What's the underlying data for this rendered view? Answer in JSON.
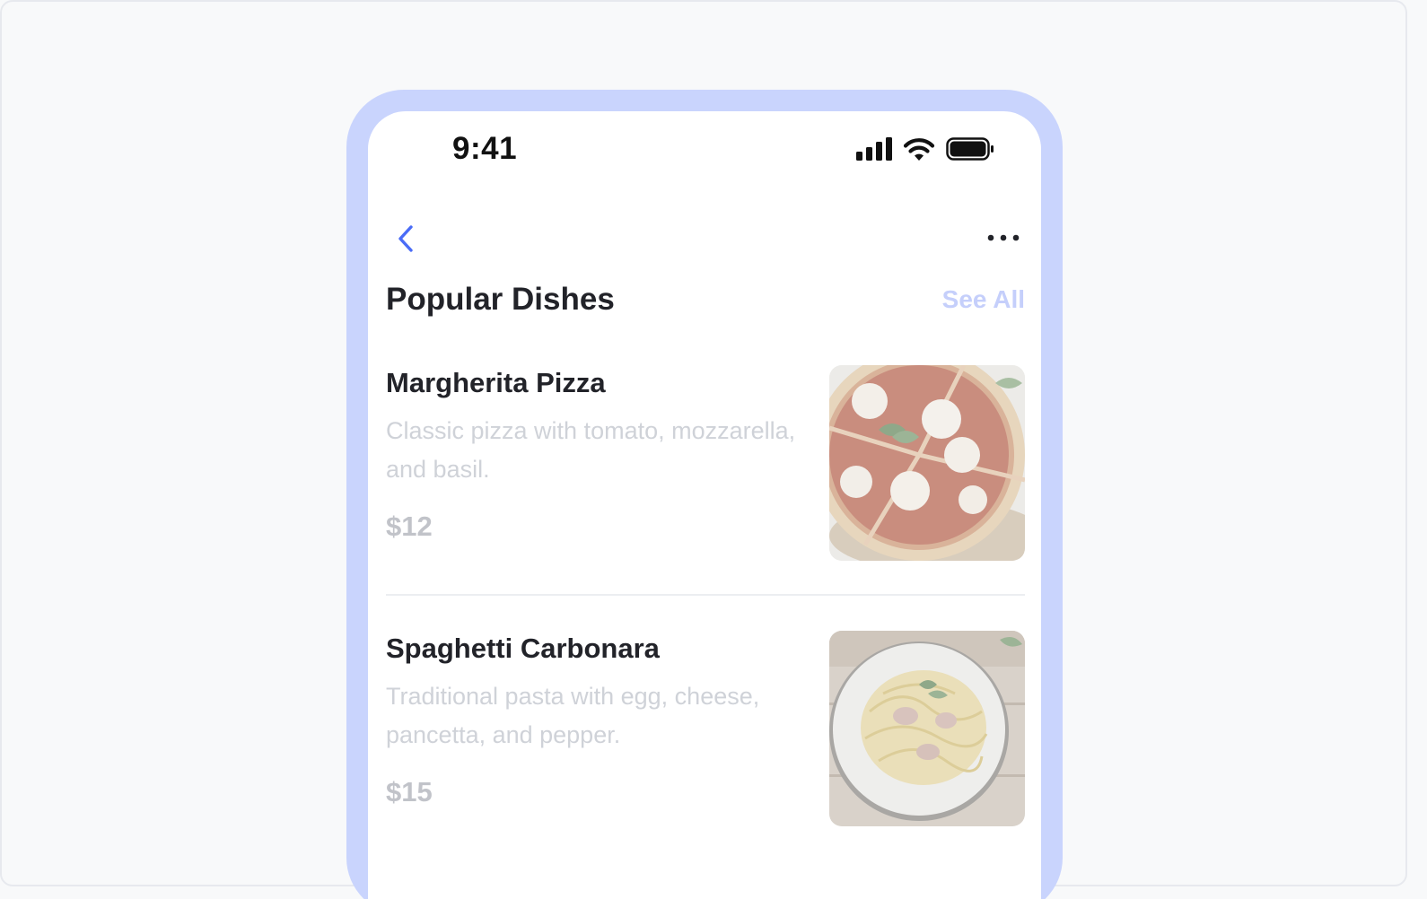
{
  "status_bar": {
    "time": "9:41",
    "icons": [
      "signal-icon",
      "wifi-icon",
      "battery-icon"
    ]
  },
  "nav": {
    "back_icon": "chevron-left-icon",
    "more_icon": "more-horizontal-icon"
  },
  "section": {
    "title": "Popular Dishes",
    "see_all": "See All"
  },
  "dishes": [
    {
      "name": "Margherita Pizza",
      "description": "Classic pizza with tomato, mozzarella, and basil.",
      "price": "$12",
      "image_icon": "pizza-image"
    },
    {
      "name": "Spaghetti Carbonara",
      "description": "Traditional pasta with egg, cheese, pancetta, and pepper.",
      "price": "$15",
      "image_icon": "pasta-image"
    }
  ],
  "colors": {
    "phone_frame": "#c9d4fd",
    "accent": "#4a6cf7",
    "see_all": "#c5cffb",
    "title": "#222329",
    "muted_text": "#cfd2d8",
    "price": "#c1c3c9"
  }
}
